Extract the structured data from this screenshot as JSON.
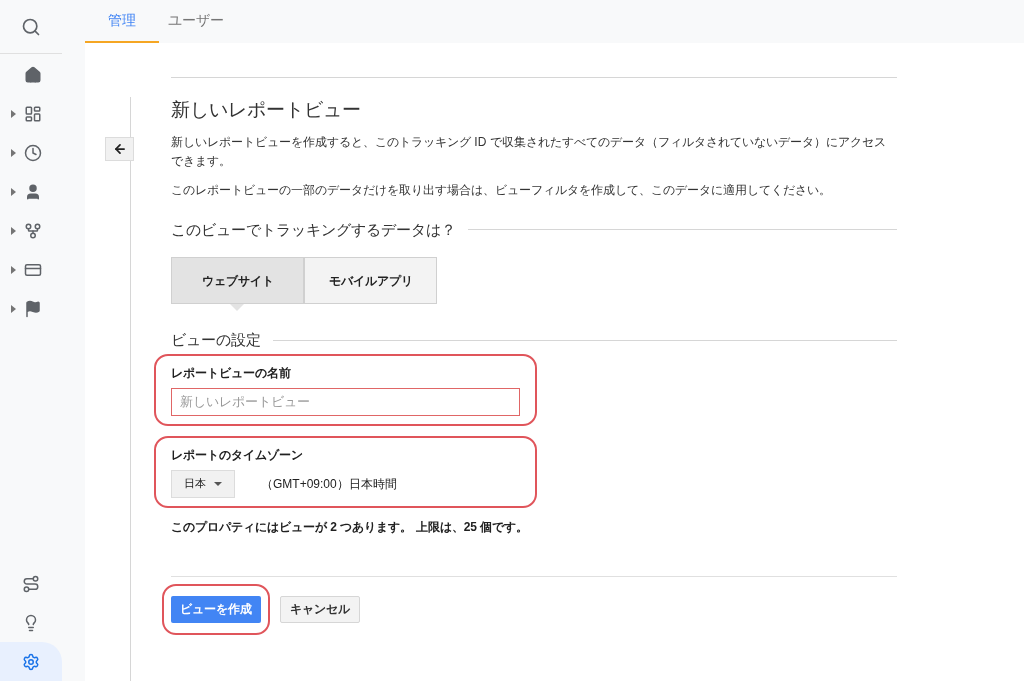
{
  "sidebar": {
    "items": [
      {
        "expandable": false
      },
      {
        "expandable": true
      },
      {
        "expandable": true
      },
      {
        "expandable": true
      },
      {
        "expandable": true
      },
      {
        "expandable": true
      },
      {
        "expandable": true
      }
    ],
    "bottom_items": [
      {
        "selected": false
      },
      {
        "selected": false
      },
      {
        "selected": true
      }
    ]
  },
  "tabs": [
    {
      "label": "管理",
      "selected": true
    },
    {
      "label": "ユーザー",
      "selected": false
    }
  ],
  "form": {
    "title": "新しいレポートビュー",
    "description": "新しいレポートビューを作成すると、このトラッキング ID で収集されたすべてのデータ（フィルタされていないデータ）にアクセスできます。",
    "note": "このレポートビューの一部のデータだけを取り出す場合は、ビューフィルタを作成して、このデータに適用してください。",
    "data_heading": "このビューでトラッキングするデータは？",
    "data_types": [
      {
        "label": "ウェブサイト",
        "selected": true
      },
      {
        "label": "モバイルアプリ",
        "selected": false
      }
    ],
    "settings_heading": "ビューの設定",
    "name_label": "レポートビューの名前",
    "name_placeholder": "新しいレポートビュー",
    "timezone_label": "レポートのタイムゾーン",
    "country": "日本",
    "timezone": "（GMT+09:00）日本時間",
    "limit_note": "このプロパティにはビューが 2 つあります。 上限は、25 個です。",
    "buttons": [
      {
        "label": "ビューを作成",
        "kind": "primary"
      },
      {
        "label": "キャンセル",
        "kind": "secondary"
      }
    ]
  }
}
